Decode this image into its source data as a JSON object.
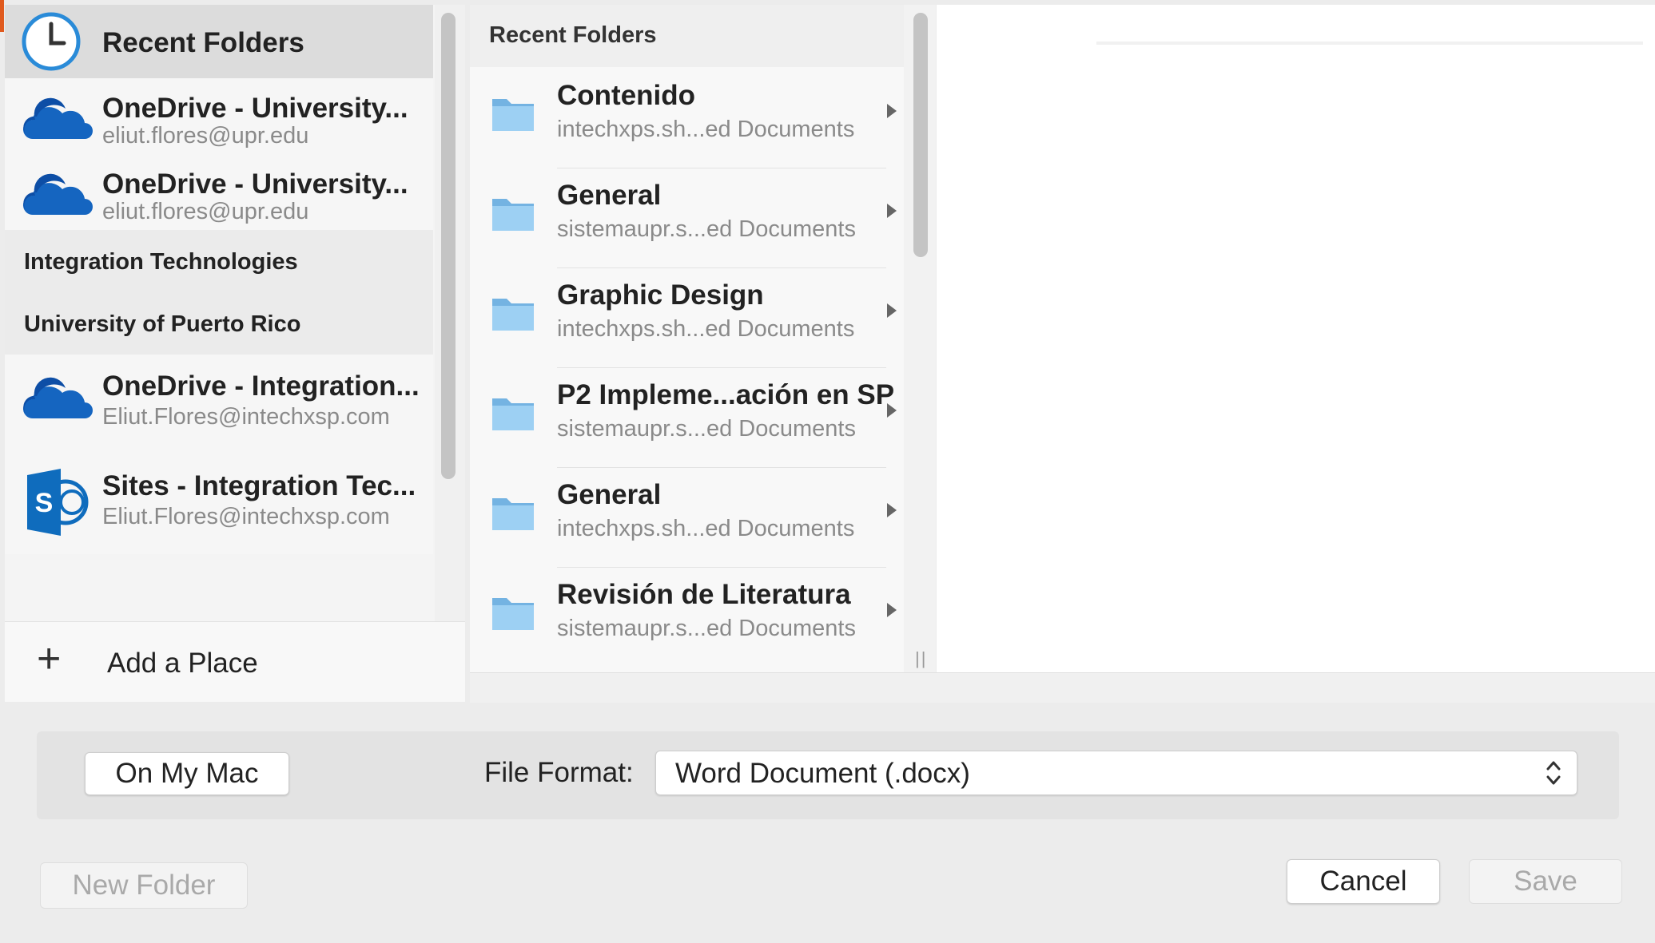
{
  "sidebar": {
    "selected": {
      "title": "Recent Folders"
    },
    "places": [
      {
        "title": "OneDrive - University...",
        "subtitle": "eliut.flores@upr.edu",
        "icon": "onedrive-cloud-icon"
      },
      {
        "title": "OneDrive - University...",
        "subtitle": "eliut.flores@upr.edu",
        "icon": "onedrive-cloud-icon"
      }
    ],
    "sections": [
      {
        "title": "Integration Technologies"
      },
      {
        "title": "University of Puerto Rico"
      }
    ],
    "places2": [
      {
        "title": "OneDrive - Integration...",
        "subtitle": "Eliut.Flores@intechxsp.com",
        "icon": "onedrive-cloud-icon"
      },
      {
        "title": "Sites - Integration Tec...",
        "subtitle": "Eliut.Flores@intechxsp.com",
        "icon": "sharepoint-icon"
      }
    ],
    "add_place": "Add a Place"
  },
  "folder_list": {
    "header": "Recent Folders",
    "folders": [
      {
        "name": "Contenido",
        "location": "intechxps.sh...ed Documents"
      },
      {
        "name": "General",
        "location": "sistemaupr.s...ed Documents"
      },
      {
        "name": "Graphic Design",
        "location": "intechxps.sh...ed Documents"
      },
      {
        "name": "P2 Impleme...ación en SP",
        "location": "sistemaupr.s...ed Documents"
      },
      {
        "name": "General",
        "location": "intechxps.sh...ed Documents"
      },
      {
        "name": "Revisión de Literatura",
        "location": "sistemaupr.s...ed Documents"
      }
    ]
  },
  "bottom": {
    "on_my_mac": "On My Mac",
    "file_format_label": "File Format:",
    "file_format_value": "Word Document (.docx)",
    "new_folder": "New Folder",
    "cancel": "Cancel",
    "save": "Save"
  },
  "colors": {
    "onedrive_blue": "#1565c0",
    "sharepoint_blue": "#0f6cbd",
    "folder_blue": "#8ec6ee",
    "clock_blue": "#2a8bd8"
  }
}
